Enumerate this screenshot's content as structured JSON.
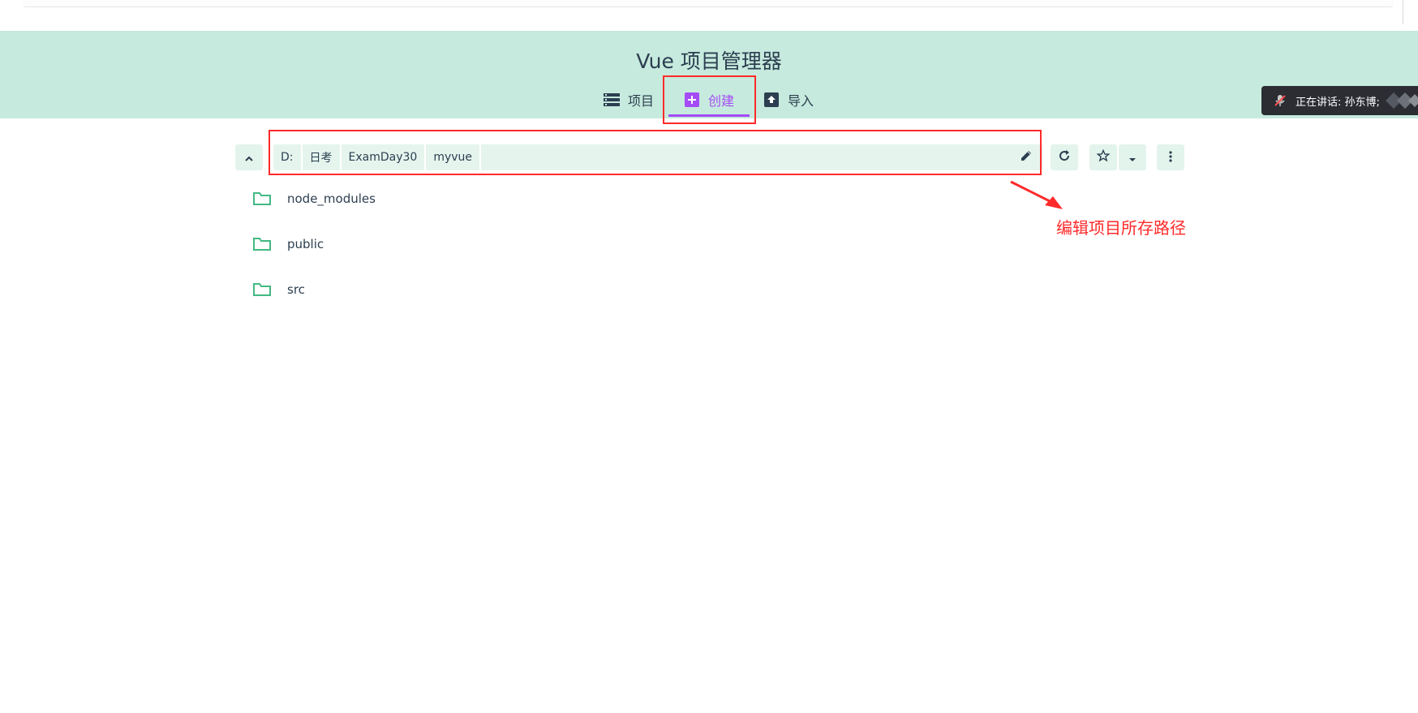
{
  "app": {
    "title": "Vue 项目管理器"
  },
  "tabs": [
    {
      "label": "项目",
      "icon": "list-icon"
    },
    {
      "label": "创建",
      "icon": "plus-square-icon",
      "active": true
    },
    {
      "label": "导入",
      "icon": "import-icon"
    }
  ],
  "notification": {
    "text": "正在讲话: 孙东博;"
  },
  "path": {
    "segments": [
      "D:",
      "日考",
      "ExamDay30",
      "myvue"
    ]
  },
  "folders": [
    {
      "name": "node_modules"
    },
    {
      "name": "public"
    },
    {
      "name": "src"
    }
  ],
  "annotation": {
    "text": "编辑项目所存路径"
  },
  "colors": {
    "header_bg": "#c6eadd",
    "accent": "#a44cf6",
    "folder": "#42b983",
    "annotation": "#ff2a2a"
  }
}
